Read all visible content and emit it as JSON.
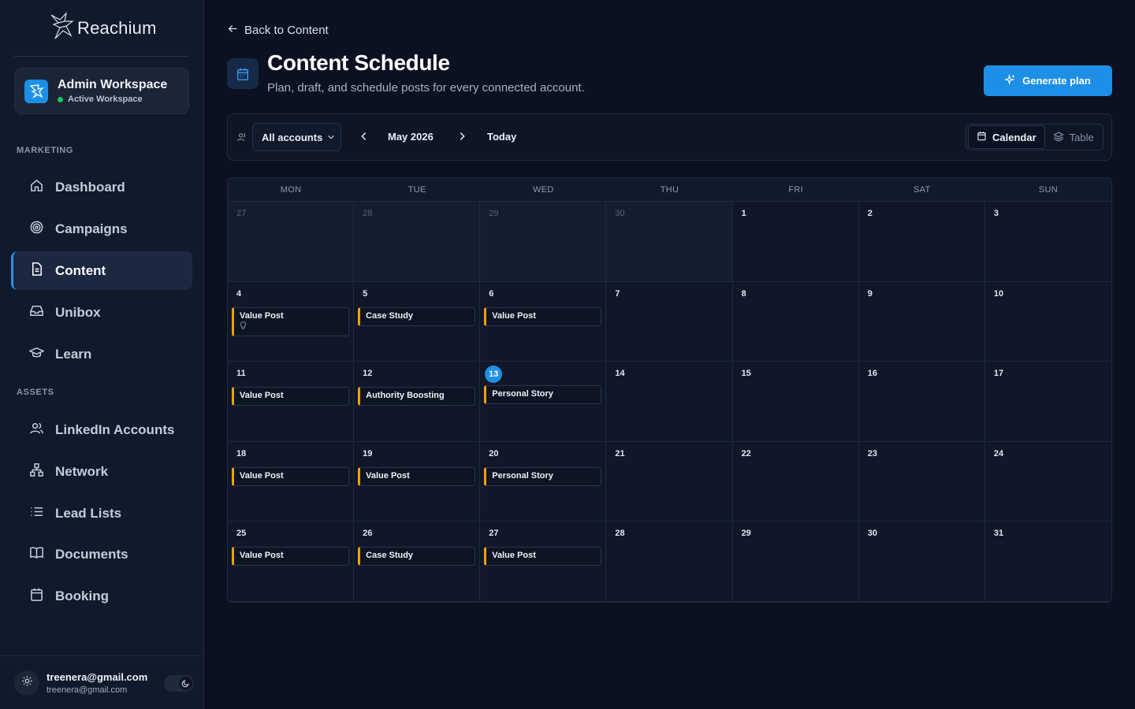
{
  "app": {
    "name": "Reachium"
  },
  "workspace": {
    "name": "Admin Workspace",
    "status": "Active Workspace"
  },
  "sidebar": {
    "sections": [
      {
        "label": "MARKETING",
        "items": [
          {
            "label": "Dashboard",
            "icon": "home-icon"
          },
          {
            "label": "Campaigns",
            "icon": "target-icon"
          },
          {
            "label": "Content",
            "icon": "document-icon",
            "active": true
          },
          {
            "label": "Unibox",
            "icon": "inbox-icon"
          },
          {
            "label": "Learn",
            "icon": "graduation-cap-icon"
          }
        ]
      },
      {
        "label": "ASSETS",
        "items": [
          {
            "label": "LinkedIn Accounts",
            "icon": "users-icon"
          },
          {
            "label": "Network",
            "icon": "network-icon"
          },
          {
            "label": "Lead Lists",
            "icon": "list-icon"
          },
          {
            "label": "Documents",
            "icon": "book-icon"
          },
          {
            "label": "Booking",
            "icon": "calendar-icon"
          }
        ]
      }
    ],
    "footer": {
      "user_main": "treenera@gmail.com",
      "user_sub": "treenera@gmail.com"
    }
  },
  "header": {
    "back_label": "Back to Content",
    "title": "Content Schedule",
    "subtitle": "Plan, draft, and schedule posts for every connected account.",
    "generate_label": "Generate plan"
  },
  "toolbar": {
    "account_filter": "All accounts",
    "month": "May 2026",
    "today_label": "Today",
    "views": {
      "calendar": "Calendar",
      "table": "Table",
      "selected": "Calendar"
    }
  },
  "calendar": {
    "weekdays": [
      "MON",
      "TUE",
      "WED",
      "THU",
      "FRI",
      "SAT",
      "SUN"
    ],
    "today": "13",
    "weeks": [
      [
        {
          "day": "27",
          "outside": true,
          "events": []
        },
        {
          "day": "28",
          "outside": true,
          "events": []
        },
        {
          "day": "29",
          "outside": true,
          "events": []
        },
        {
          "day": "30",
          "outside": true,
          "events": []
        },
        {
          "day": "1",
          "events": []
        },
        {
          "day": "2",
          "events": []
        },
        {
          "day": "3",
          "events": []
        }
      ],
      [
        {
          "day": "4",
          "events": [
            {
              "label": "Value Post",
              "bulb": true
            }
          ]
        },
        {
          "day": "5",
          "events": [
            {
              "label": "Case Study"
            }
          ]
        },
        {
          "day": "6",
          "events": [
            {
              "label": "Value Post"
            }
          ]
        },
        {
          "day": "7",
          "events": []
        },
        {
          "day": "8",
          "events": []
        },
        {
          "day": "9",
          "events": []
        },
        {
          "day": "10",
          "events": []
        }
      ],
      [
        {
          "day": "11",
          "events": [
            {
              "label": "Value Post"
            }
          ]
        },
        {
          "day": "12",
          "events": [
            {
              "label": "Authority Boosting"
            }
          ]
        },
        {
          "day": "13",
          "today": true,
          "events": [
            {
              "label": "Personal Story"
            }
          ]
        },
        {
          "day": "14",
          "events": []
        },
        {
          "day": "15",
          "events": []
        },
        {
          "day": "16",
          "events": []
        },
        {
          "day": "17",
          "events": []
        }
      ],
      [
        {
          "day": "18",
          "events": [
            {
              "label": "Value Post"
            }
          ]
        },
        {
          "day": "19",
          "events": [
            {
              "label": "Value Post"
            }
          ]
        },
        {
          "day": "20",
          "events": [
            {
              "label": "Personal Story"
            }
          ]
        },
        {
          "day": "21",
          "events": []
        },
        {
          "day": "22",
          "events": []
        },
        {
          "day": "23",
          "events": []
        },
        {
          "day": "24",
          "events": []
        }
      ],
      [
        {
          "day": "25",
          "events": [
            {
              "label": "Value Post"
            }
          ]
        },
        {
          "day": "26",
          "events": [
            {
              "label": "Case Study"
            }
          ]
        },
        {
          "day": "27",
          "events": [
            {
              "label": "Value Post"
            }
          ]
        },
        {
          "day": "28",
          "events": []
        },
        {
          "day": "29",
          "events": []
        },
        {
          "day": "30",
          "events": []
        },
        {
          "day": "31",
          "events": []
        }
      ]
    ]
  },
  "colors": {
    "accent": "#1d8fe6",
    "event_marker": "#f59e0b",
    "background": "#0b1120",
    "sidebar": "#111a2b"
  }
}
